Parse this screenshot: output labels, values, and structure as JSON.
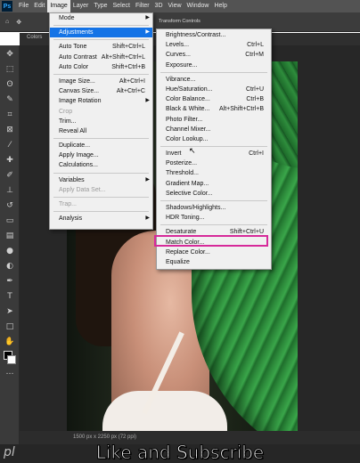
{
  "menubar": {
    "logo": "Ps",
    "items": [
      "File",
      "Edit",
      "Image",
      "Layer",
      "Type",
      "Select",
      "Filter",
      "3D",
      "View",
      "Window",
      "Help"
    ],
    "active": "Image"
  },
  "document": {
    "tab": "Colors",
    "status": "1500 px x 2250 px (72 ppi)"
  },
  "options_hint": "Transform Controls",
  "image_menu": [
    {
      "label": "Mode",
      "arrow": true
    },
    {
      "sep": true
    },
    {
      "label": "Adjustments",
      "arrow": true,
      "highlight": true
    },
    {
      "sep": true
    },
    {
      "label": "Auto Tone",
      "shortcut": "Shift+Ctrl+L"
    },
    {
      "label": "Auto Contrast",
      "shortcut": "Alt+Shift+Ctrl+L"
    },
    {
      "label": "Auto Color",
      "shortcut": "Shift+Ctrl+B"
    },
    {
      "sep": true
    },
    {
      "label": "Image Size...",
      "shortcut": "Alt+Ctrl+I"
    },
    {
      "label": "Canvas Size...",
      "shortcut": "Alt+Ctrl+C"
    },
    {
      "label": "Image Rotation",
      "arrow": true
    },
    {
      "label": "Crop",
      "disabled": true
    },
    {
      "label": "Trim..."
    },
    {
      "label": "Reveal All"
    },
    {
      "sep": true
    },
    {
      "label": "Duplicate..."
    },
    {
      "label": "Apply Image..."
    },
    {
      "label": "Calculations..."
    },
    {
      "sep": true
    },
    {
      "label": "Variables",
      "arrow": true
    },
    {
      "label": "Apply Data Set...",
      "disabled": true
    },
    {
      "sep": true
    },
    {
      "label": "Trap...",
      "disabled": true
    },
    {
      "sep": true
    },
    {
      "label": "Analysis",
      "arrow": true
    }
  ],
  "adjustments_menu": [
    {
      "label": "Brightness/Contrast..."
    },
    {
      "label": "Levels...",
      "shortcut": "Ctrl+L"
    },
    {
      "label": "Curves...",
      "shortcut": "Ctrl+M"
    },
    {
      "label": "Exposure..."
    },
    {
      "sep": true
    },
    {
      "label": "Vibrance..."
    },
    {
      "label": "Hue/Saturation...",
      "shortcut": "Ctrl+U"
    },
    {
      "label": "Color Balance...",
      "shortcut": "Ctrl+B"
    },
    {
      "label": "Black & White...",
      "shortcut": "Alt+Shift+Ctrl+B"
    },
    {
      "label": "Photo Filter..."
    },
    {
      "label": "Channel Mixer..."
    },
    {
      "label": "Color Lookup..."
    },
    {
      "sep": true
    },
    {
      "label": "Invert",
      "shortcut": "Ctrl+I"
    },
    {
      "label": "Posterize..."
    },
    {
      "label": "Threshold..."
    },
    {
      "label": "Gradient Map..."
    },
    {
      "label": "Selective Color..."
    },
    {
      "sep": true
    },
    {
      "label": "Shadows/Highlights..."
    },
    {
      "label": "HDR Toning..."
    },
    {
      "sep": true
    },
    {
      "label": "Desaturate",
      "shortcut": "Shift+Ctrl+U"
    },
    {
      "label": "Match Color...",
      "boxed": true
    },
    {
      "label": "Replace Color..."
    },
    {
      "label": "Equalize"
    }
  ],
  "watermark": "pl",
  "caption": "Like and Subscribe",
  "colors": {
    "highlight": "#1473e6",
    "annotation_box": "#d62a9a"
  },
  "tools": [
    "move-icon",
    "marquee-icon",
    "lasso-icon",
    "quick-select-icon",
    "crop-icon",
    "frame-icon",
    "eyedropper-icon",
    "healing-icon",
    "brush-icon",
    "stamp-icon",
    "history-brush-icon",
    "eraser-icon",
    "gradient-icon",
    "blur-icon",
    "dodge-icon",
    "pen-icon",
    "type-icon",
    "path-select-icon",
    "rectangle-icon",
    "hand-icon",
    "zoom-icon",
    "more-icon"
  ]
}
